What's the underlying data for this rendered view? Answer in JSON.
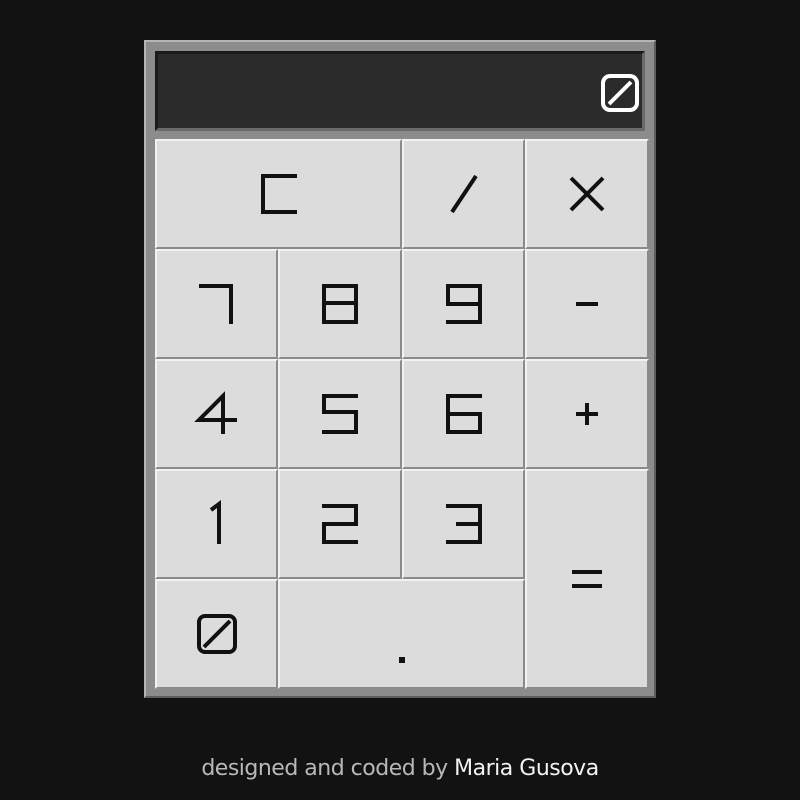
{
  "calculator": {
    "display": {
      "value": "0",
      "icon": "zero-digit-icon"
    },
    "keys": [
      {
        "id": "clear",
        "label": "C",
        "icon": "clear-glyph"
      },
      {
        "id": "divide",
        "label": "/",
        "icon": "slash-glyph"
      },
      {
        "id": "multiply",
        "label": "x",
        "icon": "cross-glyph"
      },
      {
        "id": "seven",
        "label": "7",
        "icon": "seven-glyph"
      },
      {
        "id": "eight",
        "label": "8",
        "icon": "eight-glyph"
      },
      {
        "id": "nine",
        "label": "9",
        "icon": "nine-glyph"
      },
      {
        "id": "subtract",
        "label": "-",
        "icon": "minus-glyph"
      },
      {
        "id": "four",
        "label": "4",
        "icon": "four-glyph"
      },
      {
        "id": "five",
        "label": "5",
        "icon": "five-glyph"
      },
      {
        "id": "six",
        "label": "6",
        "icon": "six-glyph"
      },
      {
        "id": "add",
        "label": "+",
        "icon": "plus-glyph"
      },
      {
        "id": "one",
        "label": "1",
        "icon": "one-glyph"
      },
      {
        "id": "two",
        "label": "2",
        "icon": "two-glyph"
      },
      {
        "id": "three",
        "label": "3",
        "icon": "three-glyph"
      },
      {
        "id": "equals",
        "label": "=",
        "icon": "equals-glyph"
      },
      {
        "id": "zero",
        "label": "0",
        "icon": "zero-glyph"
      },
      {
        "id": "decimal",
        "label": ".",
        "icon": "dot-glyph"
      }
    ]
  },
  "footer": {
    "prefix": "designed and coded by ",
    "author": "Maria Gusova"
  }
}
